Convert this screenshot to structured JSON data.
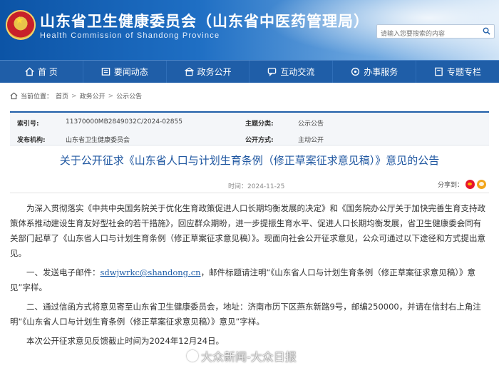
{
  "header": {
    "title": "山东省卫生健康委员会（山东省中医药管理局）",
    "subtitle": "Health Commission of Shandong Province",
    "search_placeholder": "请输入您要搜索的内容"
  },
  "nav": {
    "items": [
      {
        "label": "首 页",
        "icon": "home-icon"
      },
      {
        "label": "要闻动态",
        "icon": "news-icon"
      },
      {
        "label": "政务公开",
        "icon": "gov-open-icon"
      },
      {
        "label": "互动交流",
        "icon": "chat-icon"
      },
      {
        "label": "办事服务",
        "icon": "service-icon"
      },
      {
        "label": "专题专栏",
        "icon": "topic-icon"
      }
    ]
  },
  "breadcrumb": {
    "label": "当前位置：",
    "items": [
      "首页",
      "政务公开",
      "公示公告"
    ],
    "separator": ">"
  },
  "meta": {
    "index_label": "索引号:",
    "index_value": "11370000MB2849032C/2024-02855",
    "category_label": "主题分类:",
    "category_value": "公示公告",
    "publisher_label": "发布机构:",
    "publisher_value": "山东省卫生健康委员会",
    "mode_label": "公开方式:",
    "mode_value": "主动公开"
  },
  "article": {
    "title": "关于公开征求《山东省人口与计划生育条例（修正草案征求意见稿）》意见的公告",
    "time_label": "时间：",
    "time_value": "2024-11-25",
    "share_label": "分享到：",
    "p1": "为深入贯彻落实《中共中央国务院关于优化生育政策促进人口长期均衡发展的决定》和《国务院办公厅关于加快完善生育支持政策体系推动建设生育友好型社会的若干措施》，回应群众期盼，进一步提振生育水平、促进人口长期均衡发展，省卫生健康委会同有关部门起草了《山东省人口与计划生育条例（修正草案征求意见稿）》。现面向社会公开征求意见，公众可通过以下途径和方式提出意见。",
    "p2_prefix": "一、发送电子邮件：",
    "p2_email": "sdwjwrkc@shandong.cn",
    "p2_suffix": "，邮件标题请注明“《山东省人口与计划生育条例（修正草案征求意见稿）》意见”字样。",
    "p3": "二、通过信函方式将意见寄至山东省卫生健康委员会，地址：济南市历下区燕东新路9号，邮编250000，并请在信封右上角注明“《山东省人口与计划生育条例（修正草案征求意见稿）》意见”字样。",
    "p4": "本次公开征求意见反馈截止时间为2024年12月24日。"
  },
  "watermark": "大众新闻-大众日报",
  "colors": {
    "nav": "#1f5ea8",
    "title": "#1e56a0",
    "header_start": "#0c54a6"
  }
}
